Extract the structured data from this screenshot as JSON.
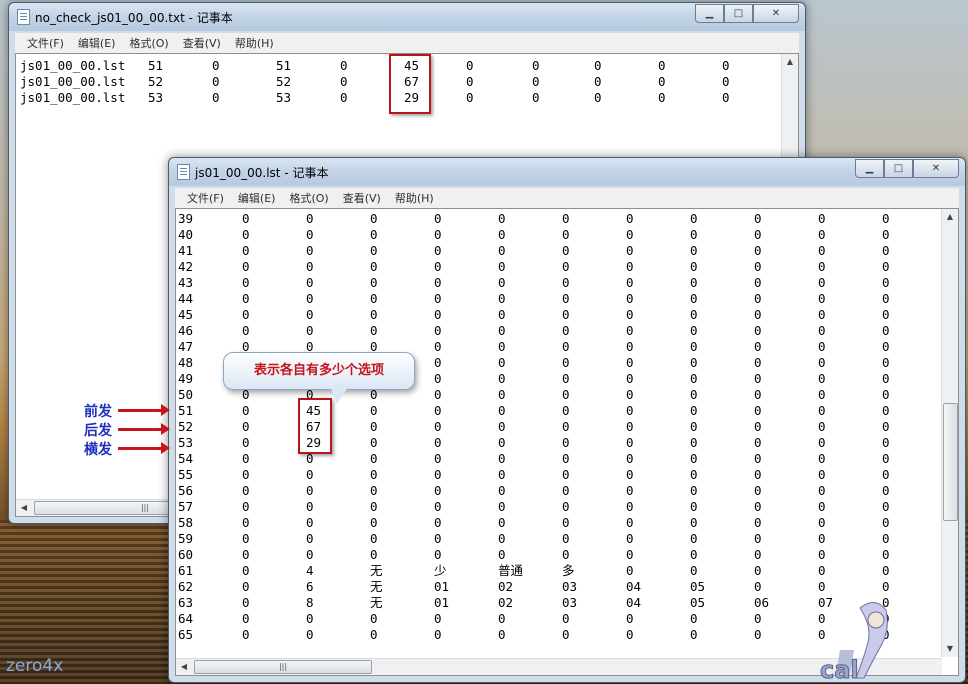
{
  "watermark": "zero4x",
  "window1": {
    "title": "no_check_js01_00_00.txt - 记事本",
    "menu": [
      "文件(F)",
      "编辑(E)",
      "格式(O)",
      "查看(V)",
      "帮助(H)"
    ],
    "rows": [
      [
        "js01_00_00.lst",
        "51",
        "0",
        "51",
        "0",
        "45",
        "0",
        "0",
        "0",
        "0",
        "0"
      ],
      [
        "js01_00_00.lst",
        "52",
        "0",
        "52",
        "0",
        "67",
        "0",
        "0",
        "0",
        "0",
        "0"
      ],
      [
        "js01_00_00.lst",
        "53",
        "0",
        "53",
        "0",
        "29",
        "0",
        "0",
        "0",
        "0",
        "0"
      ]
    ]
  },
  "window2": {
    "title": "js01_00_00.lst - 记事本",
    "menu": [
      "文件(F)",
      "编辑(E)",
      "格式(O)",
      "查看(V)",
      "帮助(H)"
    ],
    "rows": [
      [
        "39",
        "0",
        "0",
        "0",
        "0",
        "0",
        "0",
        "0",
        "0",
        "0",
        "0",
        "0"
      ],
      [
        "40",
        "0",
        "0",
        "0",
        "0",
        "0",
        "0",
        "0",
        "0",
        "0",
        "0",
        "0"
      ],
      [
        "41",
        "0",
        "0",
        "0",
        "0",
        "0",
        "0",
        "0",
        "0",
        "0",
        "0",
        "0"
      ],
      [
        "42",
        "0",
        "0",
        "0",
        "0",
        "0",
        "0",
        "0",
        "0",
        "0",
        "0",
        "0"
      ],
      [
        "43",
        "0",
        "0",
        "0",
        "0",
        "0",
        "0",
        "0",
        "0",
        "0",
        "0",
        "0"
      ],
      [
        "44",
        "0",
        "0",
        "0",
        "0",
        "0",
        "0",
        "0",
        "0",
        "0",
        "0",
        "0"
      ],
      [
        "45",
        "0",
        "0",
        "0",
        "0",
        "0",
        "0",
        "0",
        "0",
        "0",
        "0",
        "0"
      ],
      [
        "46",
        "0",
        "0",
        "0",
        "0",
        "0",
        "0",
        "0",
        "0",
        "0",
        "0",
        "0"
      ],
      [
        "47",
        "0",
        "0",
        "0",
        "0",
        "0",
        "0",
        "0",
        "0",
        "0",
        "0",
        "0"
      ],
      [
        "48",
        "0",
        "0",
        "0",
        "0",
        "0",
        "0",
        "0",
        "0",
        "0",
        "0",
        "0"
      ],
      [
        "49",
        "0",
        "0",
        "0",
        "0",
        "0",
        "0",
        "0",
        "0",
        "0",
        "0",
        "0"
      ],
      [
        "50",
        "0",
        "0",
        "0",
        "0",
        "0",
        "0",
        "0",
        "0",
        "0",
        "0",
        "0"
      ],
      [
        "51",
        "0",
        "45",
        "0",
        "0",
        "0",
        "0",
        "0",
        "0",
        "0",
        "0",
        "0"
      ],
      [
        "52",
        "0",
        "67",
        "0",
        "0",
        "0",
        "0",
        "0",
        "0",
        "0",
        "0",
        "0"
      ],
      [
        "53",
        "0",
        "29",
        "0",
        "0",
        "0",
        "0",
        "0",
        "0",
        "0",
        "0",
        "0"
      ],
      [
        "54",
        "0",
        "0",
        "0",
        "0",
        "0",
        "0",
        "0",
        "0",
        "0",
        "0",
        "0"
      ],
      [
        "55",
        "0",
        "0",
        "0",
        "0",
        "0",
        "0",
        "0",
        "0",
        "0",
        "0",
        "0"
      ],
      [
        "56",
        "0",
        "0",
        "0",
        "0",
        "0",
        "0",
        "0",
        "0",
        "0",
        "0",
        "0"
      ],
      [
        "57",
        "0",
        "0",
        "0",
        "0",
        "0",
        "0",
        "0",
        "0",
        "0",
        "0",
        "0"
      ],
      [
        "58",
        "0",
        "0",
        "0",
        "0",
        "0",
        "0",
        "0",
        "0",
        "0",
        "0",
        "0"
      ],
      [
        "59",
        "0",
        "0",
        "0",
        "0",
        "0",
        "0",
        "0",
        "0",
        "0",
        "0",
        "0"
      ],
      [
        "60",
        "0",
        "0",
        "0",
        "0",
        "0",
        "0",
        "0",
        "0",
        "0",
        "0",
        "0"
      ],
      [
        "61",
        "0",
        "4",
        "无",
        "少",
        "普通",
        "多",
        "0",
        "0",
        "0",
        "0",
        "0"
      ],
      [
        "62",
        "0",
        "6",
        "无",
        "01",
        "02",
        "03",
        "04",
        "05",
        "0",
        "0",
        "0"
      ],
      [
        "63",
        "0",
        "8",
        "无",
        "01",
        "02",
        "03",
        "04",
        "05",
        "06",
        "07",
        "0"
      ],
      [
        "64",
        "0",
        "0",
        "0",
        "0",
        "0",
        "0",
        "0",
        "0",
        "0",
        "0",
        "0"
      ],
      [
        "65",
        "0",
        "0",
        "0",
        "0",
        "0",
        "0",
        "0",
        "0",
        "0",
        "0",
        "0"
      ]
    ]
  },
  "callout": "表示各自有多少个选项",
  "side_labels": [
    "前发",
    "后发",
    "横发"
  ],
  "colors": {
    "highlight": "#b4161c",
    "label_blue": "#1f2fbf"
  }
}
